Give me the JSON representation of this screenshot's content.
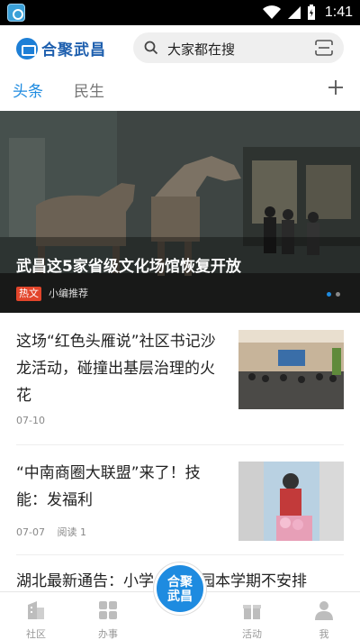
{
  "status_bar": {
    "time": "1:41"
  },
  "header": {
    "logo_text": "合聚武昌",
    "search_text": "大家都在搜"
  },
  "tabs": [
    {
      "label": "头条",
      "active": true
    },
    {
      "label": "民生",
      "active": false
    }
  ],
  "banner": {
    "title": "武昌这5家省级文化场馆恢复开放",
    "tag": "热文",
    "source": "小编推荐",
    "slide_count": 2,
    "active_slide": 1
  },
  "feed": [
    {
      "title": "这场“红色头雁说”社区书记沙龙活动，碰撞出基层治理的火花",
      "date": "07-10",
      "reads": ""
    },
    {
      "title": "“中南商圈大联盟”来了！技能：发福利",
      "date": "07-07",
      "reads": "阅读 1"
    },
    {
      "title": "湖北最新通告：小学、幼儿园本学期不安排",
      "date": "",
      "reads": ""
    }
  ],
  "bottom_nav": {
    "items": [
      {
        "label": "社区",
        "icon": "building-icon"
      },
      {
        "label": "办事",
        "icon": "grid-icon"
      },
      {
        "label": "活动",
        "icon": "gift-icon"
      },
      {
        "label": "我",
        "icon": "person-icon"
      }
    ],
    "center_line1": "合聚",
    "center_line2": "武昌"
  },
  "colors": {
    "accent": "#1e8be0",
    "hot_tag": "#e2452b"
  }
}
